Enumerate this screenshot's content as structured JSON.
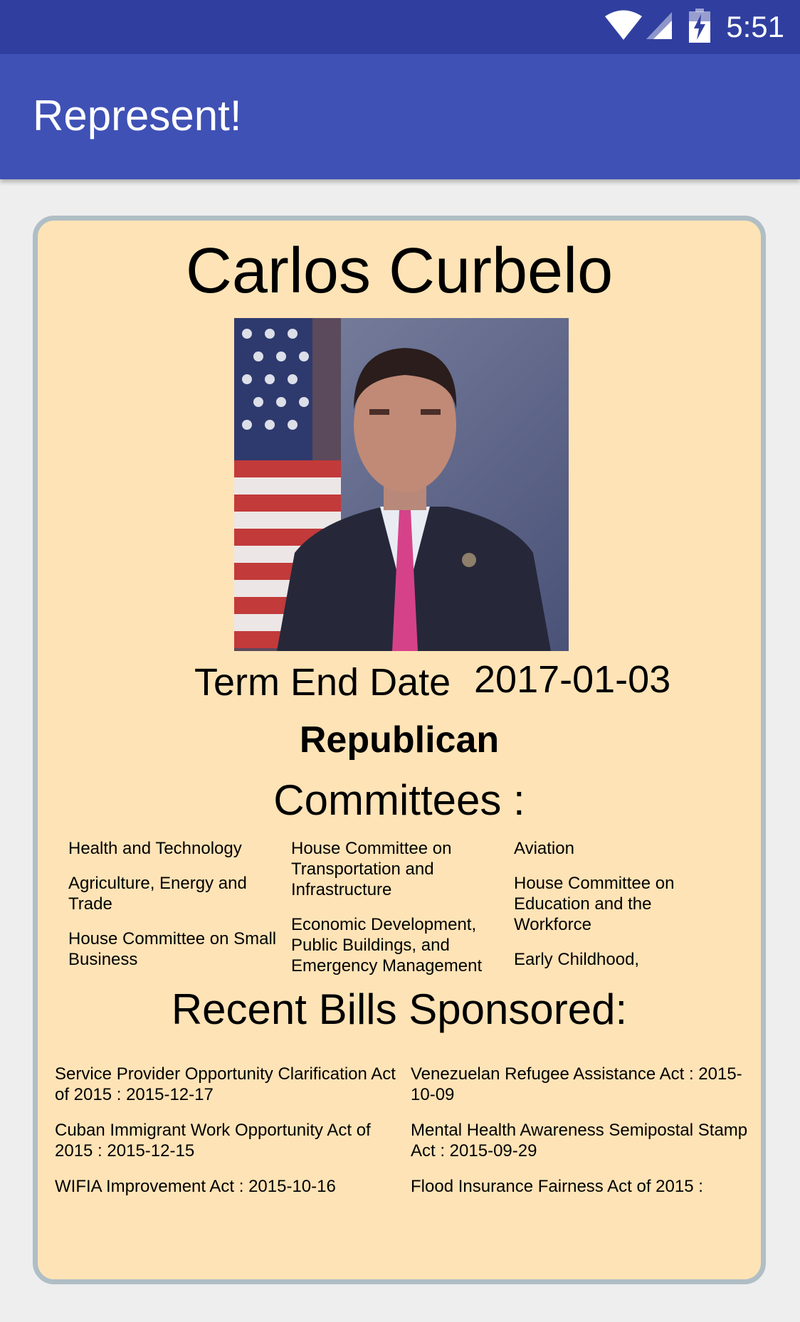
{
  "status_bar": {
    "time": "5:51",
    "icons": [
      "wifi-icon",
      "signal-icon",
      "battery-charging-icon"
    ]
  },
  "app_bar": {
    "title": "Represent!"
  },
  "profile": {
    "name": "Carlos Curbelo",
    "photo_icon": "portrait-photo",
    "term_end_label": "Term End Date",
    "term_end_value": "2017-01-03",
    "party": "Republican"
  },
  "committees": {
    "title": "Committees :",
    "columns": [
      [
        "Health and Technology",
        "Agriculture, Energy and Trade",
        "House Committee on Small Business"
      ],
      [
        "House Committee on Transportation and Infrastructure",
        "Economic Development, Public Buildings, and Emergency Management"
      ],
      [
        "Aviation",
        "House Committee on Education and the Workforce",
        "Early Childhood,"
      ]
    ]
  },
  "bills": {
    "title": "Recent Bills Sponsored:",
    "columns": [
      [
        "Service Provider Opportunity Clarification Act of 2015 : 2015-12-17",
        "Cuban Immigrant Work Opportunity Act of 2015 : 2015-12-15",
        "WIFIA Improvement Act : 2015-10-16"
      ],
      [
        "Venezuelan Refugee Assistance Act : 2015-10-09",
        "Mental Health Awareness Semipostal Stamp Act : 2015-09-29",
        "Flood Insurance Fairness Act of 2015 :"
      ]
    ]
  },
  "colors": {
    "status_bar": "#303f9f",
    "app_bar": "#3f51b5",
    "card_background": "#fee3b6",
    "card_border": "#b0bec5"
  }
}
